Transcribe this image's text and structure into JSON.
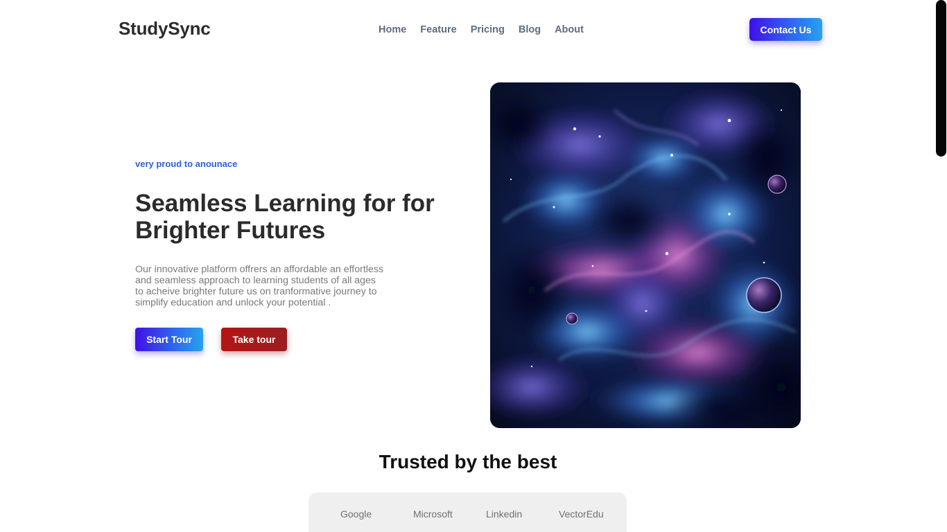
{
  "header": {
    "brand": "StudySync",
    "nav": [
      "Home",
      "Feature",
      "Pricing",
      "Blog",
      "About"
    ],
    "contact_label": "Contact Us"
  },
  "hero": {
    "tagline": "very proud to anounace",
    "title": "Seamless Learning for for Brighter Futures",
    "description": "Our innovative platform offrers an affordable an effortless and seamless approach to learning students of all ages to acheive brighter future us on tranformative journey to simplify education and unlock your potential .",
    "start_label": "Start Tour",
    "tour_label": "Take tour"
  },
  "trusted": {
    "title": "Trusted by the best",
    "logos": [
      "Google",
      "Microsoft",
      "Linkedin",
      "VectorEdu"
    ]
  },
  "colors": {
    "accent_gradient_start": "#3f10e6",
    "accent_gradient_end": "#27a3ee",
    "take_tour_red": "#b51414",
    "tagline_blue": "#2c5fd6"
  }
}
